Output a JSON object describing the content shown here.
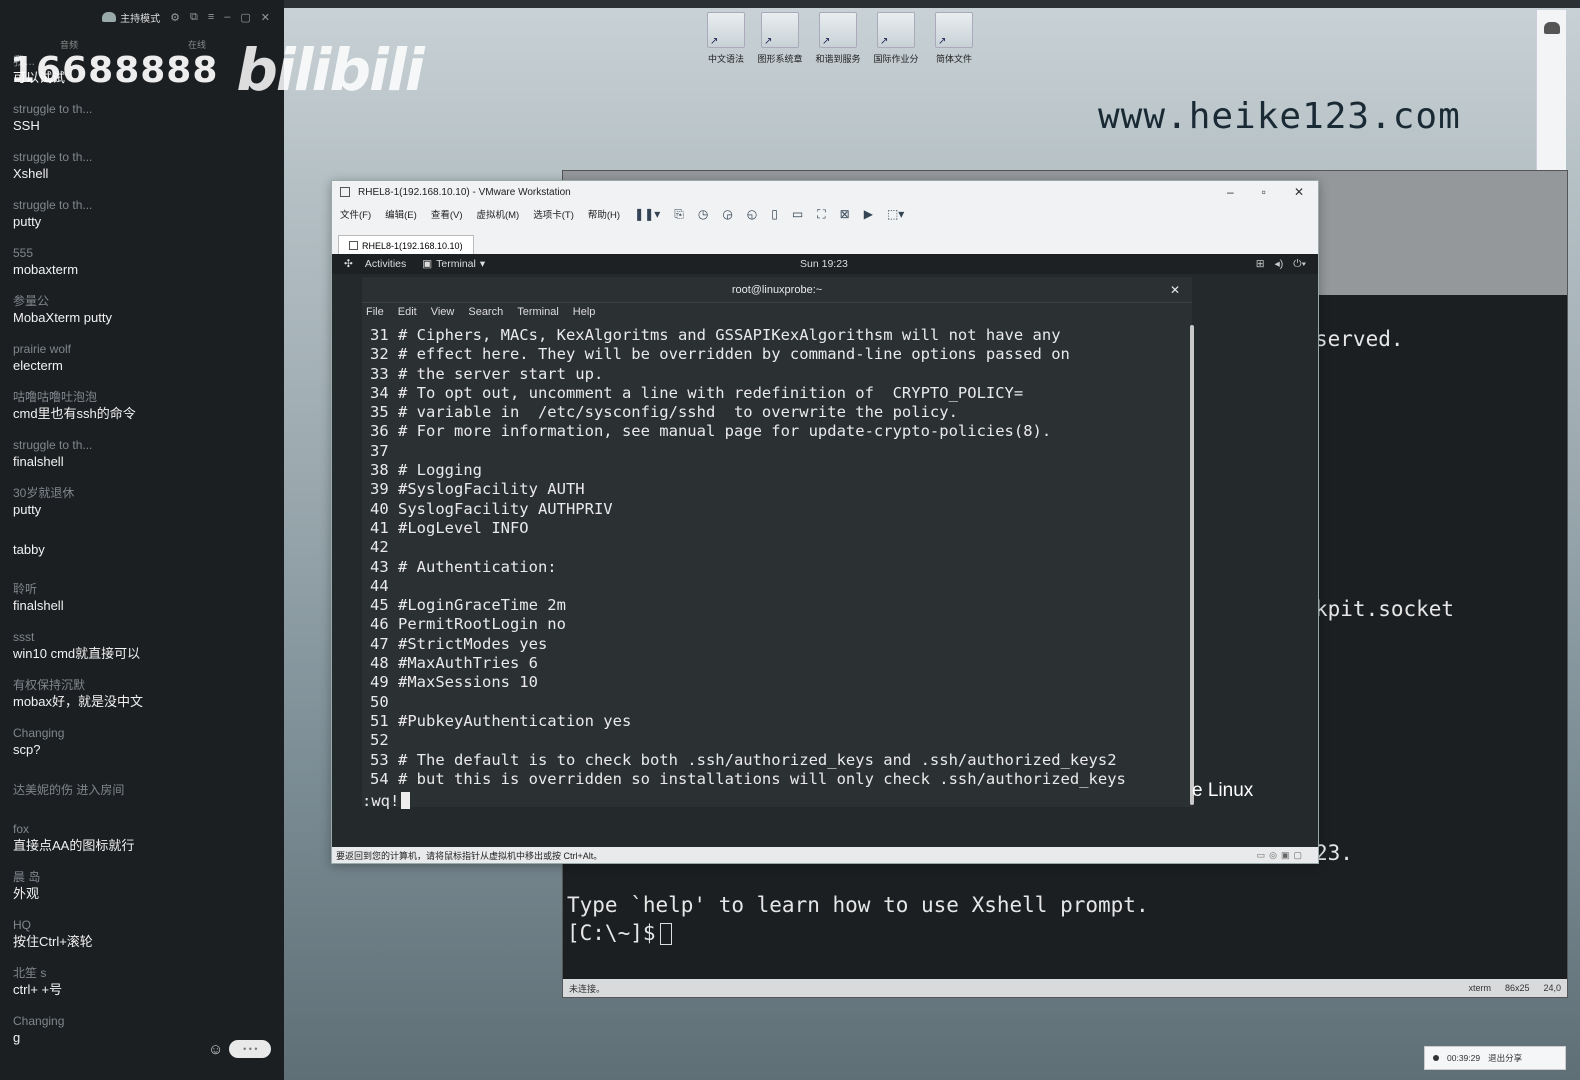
{
  "chat": {
    "mode_label": "主持模式",
    "tabs": [
      "音频",
      "在线"
    ],
    "messages": [
      {
        "user": "我...",
        "text": "可以试试"
      },
      {
        "user": "struggle to th...",
        "text": "SSH"
      },
      {
        "user": "struggle to th...",
        "text": "Xshell"
      },
      {
        "user": "struggle to th...",
        "text": "putty"
      },
      {
        "user": "555",
        "text": "mobaxterm"
      },
      {
        "user": "参量公",
        "text": "MobaXterm  putty"
      },
      {
        "user": "prairie wolf",
        "text": "electerm"
      },
      {
        "user": "咕噜咕噜吐泡泡",
        "text": "cmd里也有ssh的命令"
      },
      {
        "user": "struggle to th...",
        "text": "finalshell"
      },
      {
        "user": "30岁就退休",
        "text": "putty"
      },
      {
        "user": "",
        "text": "tabby"
      },
      {
        "user": "聆听",
        "text": "finalshell"
      },
      {
        "user": "ssst",
        "text": "win10 cmd就直接可以"
      },
      {
        "user": "有权保持沉默",
        "text": "mobax好，就是没中文"
      },
      {
        "user": "Changing",
        "text": "scp?"
      },
      {
        "user": "达美妮的伤 进入房间",
        "text": ""
      },
      {
        "user": "fox",
        "text": "直接点AA的图标就行"
      },
      {
        "user": "晨 岛",
        "text": "外观"
      },
      {
        "user": "HQ",
        "text": "按住Ctrl+滚轮"
      },
      {
        "user": "北笙 s",
        "text": "ctrl+ +号"
      },
      {
        "user": "Changing",
        "text": "g"
      }
    ]
  },
  "watermark": {
    "number": "16688888",
    "logo": "bilibili"
  },
  "desktop": {
    "site": "www.heike123.com",
    "icons": [
      "中文语法",
      "图形系统章",
      "和谐到服务",
      "国际作业分",
      "简体文件"
    ]
  },
  "xshell": {
    "frag_reserved": "served.",
    "frag_socket": "kpit.socket",
    "frag_23": "23.",
    "help_line": "Type `help' to learn how to use Xshell prompt.",
    "prompt": "[C:\\~]$",
    "status_left": "未连接。",
    "status_term": "xterm",
    "status_size": "86x25",
    "status_pos": "24,0"
  },
  "vmware": {
    "title": "RHEL8-1(192.168.10.10) - VMware Workstation",
    "menu": [
      "文件(F)",
      "编辑(E)",
      "查看(V)",
      "虚拟机(M)",
      "选项卡(T)",
      "帮助(H)"
    ],
    "tab": "RHEL8-1(192.168.10.10)",
    "status": "要返回到您的计算机，请将鼠标指针从虚拟机中移出或按 Ctrl+Alt。"
  },
  "gnome": {
    "activities": "Activities",
    "app": "Terminal",
    "clock": "Sun 19:23"
  },
  "terminal": {
    "title": "root@linuxprobe:~",
    "menu": [
      "File",
      "Edit",
      "View",
      "Search",
      "Terminal",
      "Help"
    ],
    "lines": [
      "31 # Ciphers, MACs, KexAlgoritms and GSSAPIKexAlgorithsm will not have any",
      "32 # effect here. They will be overridden by command-line options passed on",
      "33 # the server start up.",
      "34 # To opt out, uncomment a line with redefinition of  CRYPTO_POLICY=",
      "35 # variable in  /etc/sysconfig/sshd  to overwrite the policy.",
      "36 # For more information, see manual page for update-crypto-policies(8).",
      "37",
      "38 # Logging",
      "39 #SyslogFacility AUTH",
      "40 SyslogFacility AUTHPRIV",
      "41 #LogLevel INFO",
      "42",
      "43 # Authentication:",
      "44",
      "45 #LoginGraceTime 2m",
      "46 PermitRootLogin no",
      "47 #StrictModes yes",
      "48 #MaxAuthTries 6",
      "49 #MaxSessions 10",
      "50",
      "51 #PubkeyAuthentication yes",
      "52",
      "53 # The default is to check both .ssh/authorized_keys and .ssh/authorized_keys2",
      "54 # but this is overridden so installations will only check .ssh/authorized_keys"
    ],
    "command": ":wq!",
    "frag_linux": "e Linux"
  },
  "notif": {
    "time": "00:39:29",
    "action": "退出分享"
  }
}
